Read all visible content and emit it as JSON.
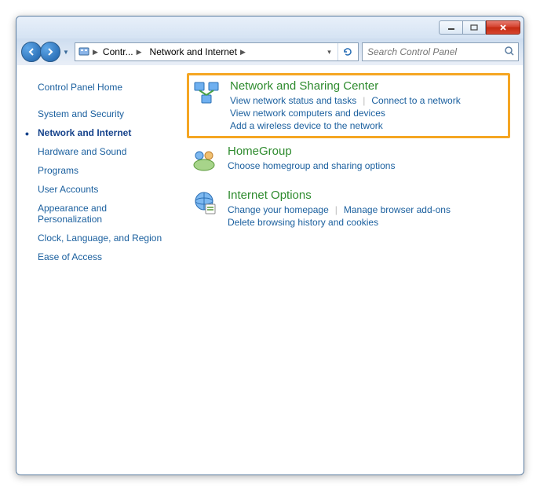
{
  "breadcrumb": {
    "root_label": "Contr...",
    "current_label": "Network and Internet"
  },
  "search": {
    "placeholder": "Search Control Panel"
  },
  "sidebar": {
    "items": [
      {
        "label": "Control Panel Home",
        "current": false
      },
      {
        "label": "System and Security",
        "current": false
      },
      {
        "label": "Network and Internet",
        "current": true
      },
      {
        "label": "Hardware and Sound",
        "current": false
      },
      {
        "label": "Programs",
        "current": false
      },
      {
        "label": "User Accounts",
        "current": false
      },
      {
        "label": "Appearance and Personalization",
        "current": false
      },
      {
        "label": "Clock, Language, and Region",
        "current": false
      },
      {
        "label": "Ease of Access",
        "current": false
      }
    ]
  },
  "categories": [
    {
      "title": "Network and Sharing Center",
      "highlighted": true,
      "icon": "network-sharing",
      "links": [
        "View network status and tasks",
        "Connect to a network",
        "View network computers and devices",
        "Add a wireless device to the network"
      ],
      "breaks_after": [
        1,
        2
      ]
    },
    {
      "title": "HomeGroup",
      "highlighted": false,
      "icon": "homegroup",
      "links": [
        "Choose homegroup and sharing options"
      ],
      "breaks_after": []
    },
    {
      "title": "Internet Options",
      "highlighted": false,
      "icon": "internet-options",
      "links": [
        "Change your homepage",
        "Manage browser add-ons",
        "Delete browsing history and cookies"
      ],
      "breaks_after": [
        1
      ]
    }
  ]
}
